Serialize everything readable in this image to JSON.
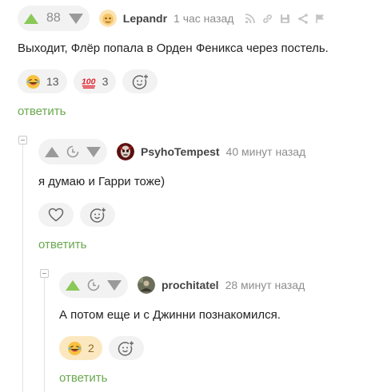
{
  "comments": [
    {
      "rating": "88",
      "username": "Lepandr",
      "time": "1 час назад",
      "text": "Выходит, Флёр попала в Орден Феникса через постель.",
      "reactions": [
        {
          "emoji": "laughing-emoji",
          "count": "13"
        },
        {
          "emoji": "hundred-emoji",
          "count": "3"
        }
      ],
      "reply_label": "ответить"
    },
    {
      "username": "PsyhoTempest",
      "time": "40 минут назад",
      "text": "я думаю и Гарри тоже)",
      "reply_label": "ответить"
    },
    {
      "username": "prochitatel",
      "time": "28 минут назад",
      "text": "А потом еще и с Джинни познакомился.",
      "reactions": [
        {
          "emoji": "laughing-emoji",
          "count": "2"
        }
      ],
      "reply_label": "ответить"
    }
  ],
  "colors": {
    "upvote_active": "#8ac858",
    "reply_link": "#6aa84f",
    "reaction_active_bg": "#fce8c0"
  },
  "icons": [
    "arrow-up-icon",
    "arrow-down-icon",
    "clock-icon",
    "rss-icon",
    "link-icon",
    "save-icon",
    "share-icon",
    "flag-icon",
    "heart-icon",
    "add-reaction-icon",
    "collapse-icon"
  ]
}
